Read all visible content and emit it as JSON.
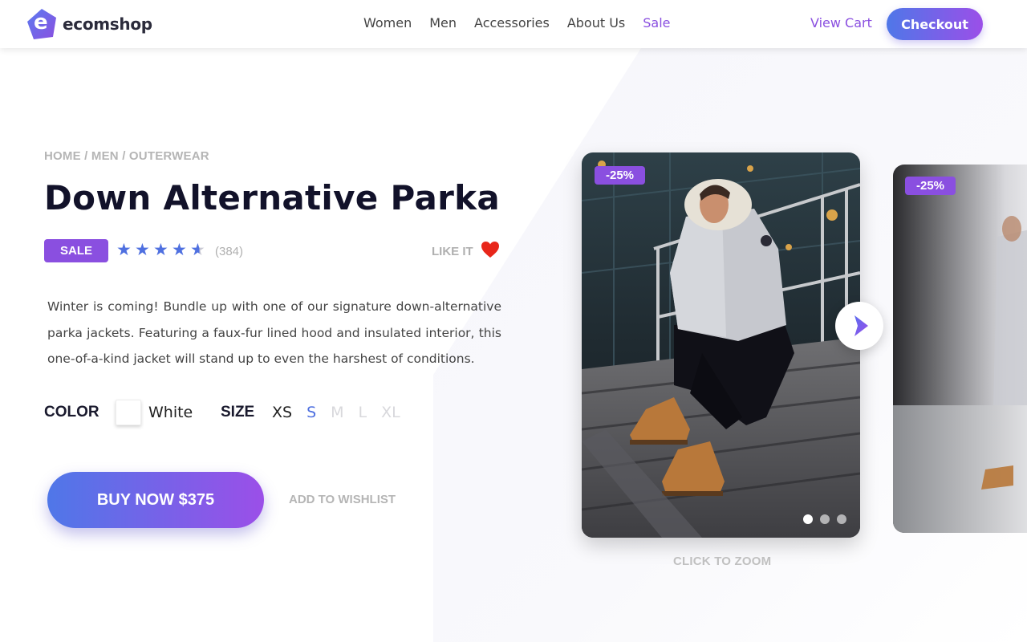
{
  "header": {
    "brand": "ecomshop",
    "logo_letter": "e",
    "nav": [
      "Women",
      "Men",
      "Accessories",
      "About Us",
      "Sale"
    ],
    "view_cart": "View Cart",
    "checkout": "Checkout"
  },
  "product": {
    "breadcrumb": "HOME / MEN / OUTERWEAR",
    "title": "Down Alternative Parka",
    "badge": "SALE",
    "rating": 4.5,
    "rating_max": 5,
    "reviews": "(384)",
    "like_label": "LIKE IT",
    "description": "Winter is coming! Bundle up with one of our signature down-alternative parka jackets. Featuring a faux-fur lined hood and insulated interior, this one-of-a-kind jacket will stand up to even the harshest of conditions.",
    "color_label": "COLOR",
    "color_value": "White",
    "size_label": "SIZE",
    "sizes": [
      "XS",
      "S",
      "M",
      "L",
      "XL"
    ],
    "selected_size": "S",
    "available_sizes": [
      "XS",
      "S"
    ],
    "buy_now": "BUY NOW $375",
    "wishlist": "ADD TO WISHLIST"
  },
  "gallery": {
    "discount": "-25%",
    "zoom_hint": "CLICK TO ZOOM",
    "slide_count": 3,
    "active_slide": 1
  },
  "colors": {
    "accent_purple": "#8a4fe0",
    "accent_blue": "#4f70e0",
    "heart_red": "#e8261a"
  }
}
